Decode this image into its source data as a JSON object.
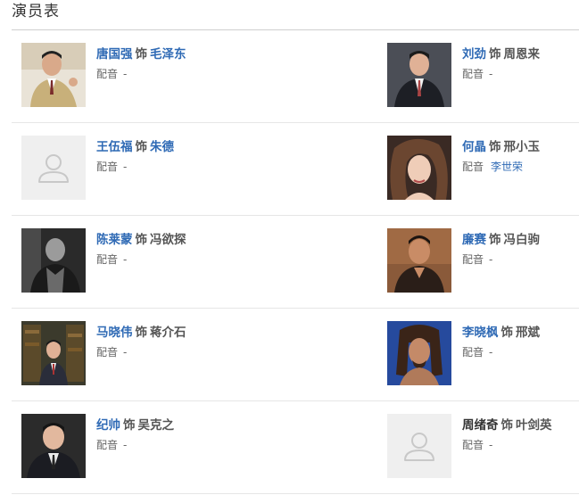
{
  "section_title": "演员表",
  "label_as": "饰",
  "label_dubbing": "配音",
  "cast": [
    {
      "actor": "唐国强",
      "role": "毛泽东",
      "dubbing": "-",
      "role_link": true,
      "has_photo": true,
      "photo_icon": "portrait-photo"
    },
    {
      "actor": "刘劲",
      "role": "周恩来",
      "dubbing": "-",
      "role_link": false,
      "has_photo": true,
      "photo_icon": "portrait-photo"
    },
    {
      "actor": "王伍福",
      "role": "朱德",
      "dubbing": "-",
      "role_link": true,
      "has_photo": false,
      "photo_icon": "person-placeholder-icon"
    },
    {
      "actor": "何晶",
      "role": "邢小玉",
      "dubbing": "李世荣",
      "role_link": false,
      "has_photo": true,
      "photo_icon": "portrait-photo"
    },
    {
      "actor": "陈莱蒙",
      "role": "冯欲探",
      "dubbing": "-",
      "role_link": false,
      "has_photo": true,
      "photo_icon": "portrait-photo"
    },
    {
      "actor": "廉赛",
      "role": "冯白驹",
      "dubbing": "-",
      "role_link": false,
      "has_photo": true,
      "photo_icon": "portrait-photo"
    },
    {
      "actor": "马晓伟",
      "role": "蒋介石",
      "dubbing": "-",
      "role_link": false,
      "has_photo": true,
      "photo_icon": "portrait-photo"
    },
    {
      "actor": "李晓枫",
      "role": "邢斌",
      "dubbing": "-",
      "role_link": false,
      "has_photo": true,
      "photo_icon": "portrait-photo"
    },
    {
      "actor": "纪帅",
      "role": "吴克之",
      "dubbing": "-",
      "role_link": false,
      "has_photo": true,
      "photo_icon": "portrait-photo"
    },
    {
      "actor": "周绪奇",
      "role": "叶剑英",
      "dubbing": "-",
      "role_link": false,
      "actor_link": false,
      "has_photo": false,
      "photo_icon": "person-placeholder-icon"
    }
  ],
  "colors": {
    "link": "#2f6ab5",
    "text": "#333333",
    "muted": "#666666",
    "divider": "#e6e6e6",
    "placeholder_bg": "#efefef"
  }
}
